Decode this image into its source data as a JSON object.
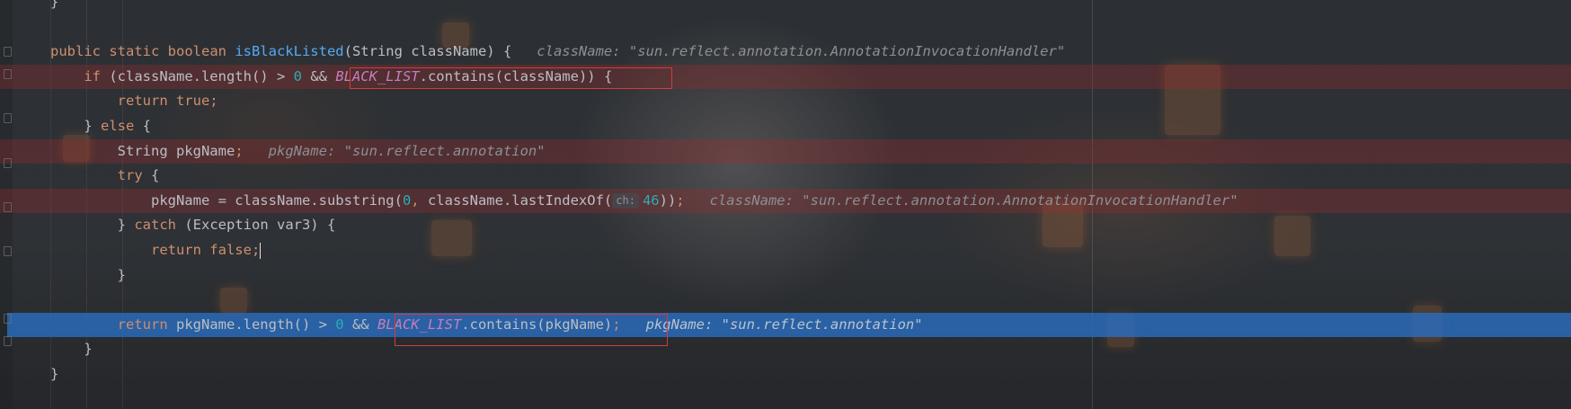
{
  "editor": {
    "lines": [
      {
        "id": "l0",
        "tokens": [
          {
            "t": "}",
            "c": "plain"
          }
        ]
      },
      {
        "id": "l1",
        "tokens": []
      },
      {
        "id": "l2",
        "tokens": [
          {
            "t": "public ",
            "c": "kw"
          },
          {
            "t": "static ",
            "c": "kw"
          },
          {
            "t": "boolean ",
            "c": "kw"
          },
          {
            "t": "isBlackListed",
            "c": "fn"
          },
          {
            "t": "(String className) {",
            "c": "plain"
          },
          {
            "t": "   className: \"sun.reflect.annotation.AnnotationInvocationHandler\"",
            "c": "hint"
          }
        ]
      },
      {
        "id": "l3",
        "tokens": [
          {
            "t": "    ",
            "c": "plain"
          },
          {
            "t": "if ",
            "c": "kw"
          },
          {
            "t": "(className.length() > ",
            "c": "plain"
          },
          {
            "t": "0",
            "c": "num"
          },
          {
            "t": " && ",
            "c": "plain"
          },
          {
            "t": "BLACK_LIST",
            "c": "const"
          },
          {
            "t": ".contains(className)) {",
            "c": "plain"
          }
        ]
      },
      {
        "id": "l4",
        "tokens": [
          {
            "t": "        ",
            "c": "plain"
          },
          {
            "t": "return true;",
            "c": "kw"
          }
        ]
      },
      {
        "id": "l5",
        "tokens": [
          {
            "t": "    } ",
            "c": "plain"
          },
          {
            "t": "else",
            "c": "kw"
          },
          {
            "t": " {",
            "c": "plain"
          }
        ]
      },
      {
        "id": "l6",
        "tokens": [
          {
            "t": "        String pkgName",
            "c": "plain"
          },
          {
            "t": ";",
            "c": "kw"
          },
          {
            "t": "   pkgName: \"sun.reflect.annotation\"",
            "c": "hint"
          }
        ]
      },
      {
        "id": "l7",
        "tokens": [
          {
            "t": "        ",
            "c": "plain"
          },
          {
            "t": "try",
            "c": "kw"
          },
          {
            "t": " {",
            "c": "plain"
          }
        ]
      },
      {
        "id": "l8",
        "tokens": [
          {
            "t": "            pkgName = className.substring(",
            "c": "plain"
          },
          {
            "t": "0",
            "c": "num"
          },
          {
            "t": ", ",
            "c": "kw"
          },
          {
            "t": "className.lastIndexOf(",
            "c": "plain"
          },
          {
            "t": "ch:",
            "c": "param"
          },
          {
            "t": "46",
            "c": "num"
          },
          {
            "t": "))",
            "c": "plain"
          },
          {
            "t": ";",
            "c": "kw"
          },
          {
            "t": "   className: \"sun.reflect.annotation.AnnotationInvocationHandler\"",
            "c": "hint"
          }
        ]
      },
      {
        "id": "l9",
        "tokens": [
          {
            "t": "        } ",
            "c": "plain"
          },
          {
            "t": "catch",
            "c": "kw"
          },
          {
            "t": " (Exception var3) {",
            "c": "plain"
          }
        ]
      },
      {
        "id": "l10",
        "tokens": [
          {
            "t": "            ",
            "c": "plain"
          },
          {
            "t": "return false;",
            "c": "kw"
          },
          {
            "t": "",
            "c": "caret"
          }
        ]
      },
      {
        "id": "l11",
        "tokens": [
          {
            "t": "        }",
            "c": "plain"
          }
        ]
      },
      {
        "id": "l12",
        "tokens": []
      },
      {
        "id": "l13",
        "tokens": [
          {
            "t": "        ",
            "c": "plain"
          },
          {
            "t": "return ",
            "c": "kw"
          },
          {
            "t": "pkgName.length() > ",
            "c": "plain"
          },
          {
            "t": "0",
            "c": "num"
          },
          {
            "t": " && ",
            "c": "plain"
          },
          {
            "t": "BLACK_LIST",
            "c": "const"
          },
          {
            "t": ".contains(pkgName)",
            "c": "plain"
          },
          {
            "t": ";",
            "c": "kw"
          },
          {
            "t": "   pkgName: \"sun.reflect.annotation\"",
            "c": "hint"
          }
        ]
      },
      {
        "id": "l14",
        "tokens": [
          {
            "t": "    }",
            "c": "plain"
          }
        ]
      },
      {
        "id": "l15",
        "tokens": [
          {
            "t": "}",
            "c": "plain"
          }
        ]
      }
    ]
  },
  "colors": {
    "keyword": "#cf8e6d",
    "function": "#56a8f5",
    "number": "#2aacb8",
    "constant": "#c77dbb",
    "breakpoint_row": "#a02d2d",
    "execution_row": "#2a6cbe",
    "highlight_box": "#d23c3c"
  }
}
